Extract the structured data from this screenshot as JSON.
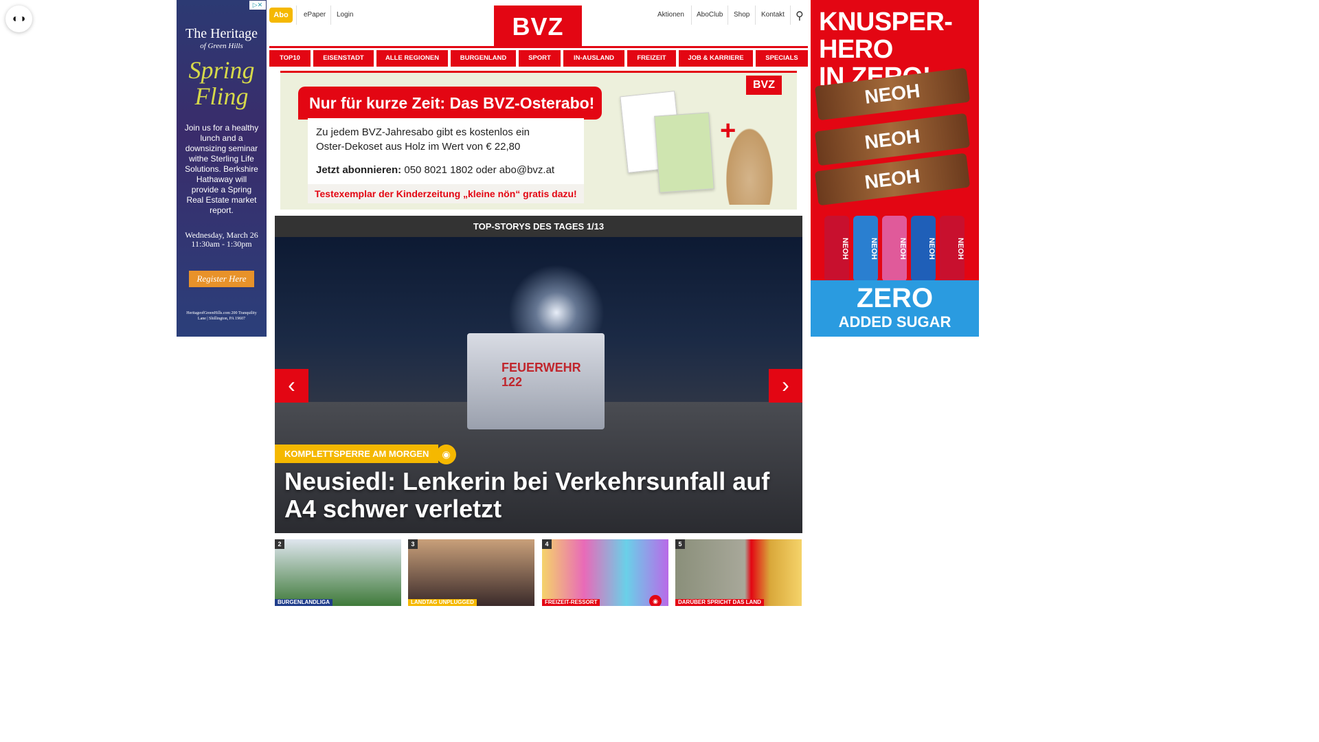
{
  "accessibility": {
    "glyph": "◐◑"
  },
  "ad_left": {
    "close": "▷✕",
    "title": "The Heritage",
    "subtitle": "of Green Hills",
    "headline": "Spring Fling",
    "body": "Join us for a healthy lunch and a downsizing seminar withe Sterling Life Solutions. Berkshire Hathaway will provide a Spring Real Estate market report.",
    "date": "Wednesday, March 26",
    "time": "11:30am - 1:30pm",
    "button": "Register Here",
    "footer": "HeritageofGreenHills.com 200 Tranquility Lane | Shillington, PA 19607"
  },
  "ad_right": {
    "headline1": "KNUSPER-HERO",
    "headline2": "IN ZERO!",
    "bar_label": "NEOH",
    "pack_label": "NEOH",
    "footer1": "ZERO",
    "footer2": "ADDED SUGAR"
  },
  "header": {
    "abo": "Abo",
    "links_left": [
      "ePaper",
      "Login"
    ],
    "logo": "BVZ",
    "links_right": [
      "Aktionen",
      "AboClub",
      "Shop",
      "Kontakt"
    ],
    "search_icon": "⚲"
  },
  "nav": [
    "TOP10",
    "EISENSTADT",
    "ALLE REGIONEN",
    "BURGENLAND",
    "SPORT",
    "IN-AUSLAND",
    "FREIZEIT",
    "JOB & KARRIERE",
    "SPECIALS"
  ],
  "promo": {
    "headline": "Nur für kurze Zeit: Das BVZ-Osterabo!",
    "line1": "Zu jedem BVZ-Jahresabo gibt es kostenlos ein",
    "line2": "Oster-Dekoset aus Holz im Wert von € 22,80",
    "cta_bold": "Jetzt abonnieren:",
    "cta_rest": " 050 8021 1802 oder abo@bvz.at",
    "footer": "Testexemplar der Kinderzeitung „kleine nön“ gratis dazu!",
    "logo": "BVZ",
    "plus": "+"
  },
  "top_stories": {
    "header": "TOP-STORYS DES TAGES 1/13",
    "prev": "‹",
    "next": "›",
    "kicker": "KOMPLETTSPERRE AM MORGEN",
    "camera": "◉",
    "headline": "Neusiedl: Lenkerin bei Verkehrsunfall auf A4 schwer verletzt",
    "truck_text": "FEUERWEHR 122"
  },
  "thumbnails": [
    {
      "num": "2",
      "tag": "BURGENLANDLIGA",
      "bg": "#5a8fb8"
    },
    {
      "num": "3",
      "tag": "LANDTAG UNPLUGGED",
      "bg": "#6b3a2a"
    },
    {
      "num": "4",
      "tag": "FREIZEIT-RESSORT",
      "bg": "#d86ad0"
    },
    {
      "num": "5",
      "tag": "DARÜBER SPRICHT DAS LAND",
      "bg": "#8a8f7a"
    }
  ]
}
